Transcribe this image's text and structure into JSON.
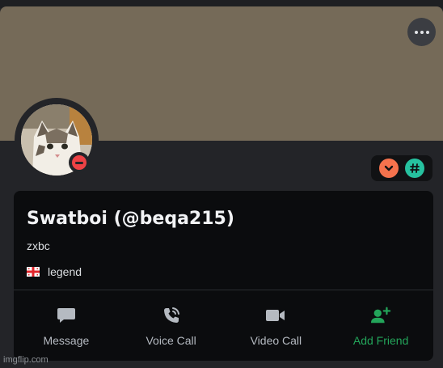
{
  "profile": {
    "name_line": "Swatboi (@beqa215)",
    "pronoun_line": "zxbc",
    "custom_status": "legend"
  },
  "actions": [
    {
      "label": "Message",
      "icon": "message-icon"
    },
    {
      "label": "Voice Call",
      "icon": "voice-call-icon"
    },
    {
      "label": "Video Call",
      "icon": "video-call-icon"
    },
    {
      "label": "Add Friend",
      "icon": "add-friend-icon"
    }
  ],
  "badges": [
    {
      "icon": "chevron-down-badge-icon",
      "color": "#f5724d"
    },
    {
      "icon": "hashtag-badge-icon",
      "color": "#26c2a0"
    }
  ],
  "status": {
    "state": "do-not-disturb",
    "color": "#ed4245"
  },
  "banner_color": "#756a58",
  "accent_green": "#23a55a",
  "watermark": "imgflip.com"
}
